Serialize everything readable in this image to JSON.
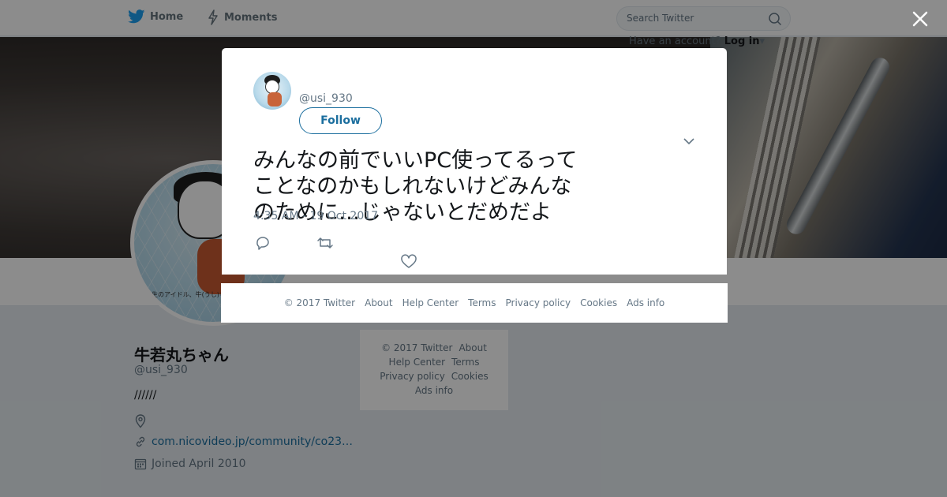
{
  "topbar": {
    "home_label": "Home",
    "moments_label": "Moments",
    "search_placeholder": "Search Twitter",
    "login_prompt": "Have an account?",
    "login_label": "Log in"
  },
  "profile": {
    "name": "牛若丸ちゃん",
    "handle": "@usi_930",
    "bio": "//////",
    "url": "com.nicovideo.jp/community/co23…",
    "joined": "Joined April 2010",
    "avatar_caption": "生のアイドル、牛(うし)ちゃん！"
  },
  "side_footer": {
    "copyright": "© 2017 Twitter",
    "about": "About",
    "help_center": "Help Center",
    "terms": "Terms",
    "privacy": "Privacy policy",
    "cookies": "Cookies",
    "ads_info": "Ads info"
  },
  "modal": {
    "handle": "@usi_930",
    "follow_label": "Follow",
    "tweet_text": "みんなの前でいいPC使ってるってことなのかもしれないけどみんなのために…じゃないとだめだよ",
    "timestamp": "4:35 AM - 19 Oct 2017"
  },
  "footer": {
    "copyright": "© 2017 Twitter",
    "about": "About",
    "help_center": "Help Center",
    "terms": "Terms",
    "privacy": "Privacy policy",
    "cookies": "Cookies",
    "ads_info": "Ads info"
  },
  "colors": {
    "accent": "#1b6e9e",
    "twitter_blue": "#1da1f2",
    "overlay": "rgba(0,0,0,0.45)"
  },
  "icons": [
    "twitter-bird-icon",
    "lightning-icon",
    "search-icon",
    "close-icon",
    "chevron-down-icon",
    "reply-icon",
    "retweet-icon",
    "heart-icon",
    "location-icon",
    "link-icon",
    "calendar-icon"
  ]
}
